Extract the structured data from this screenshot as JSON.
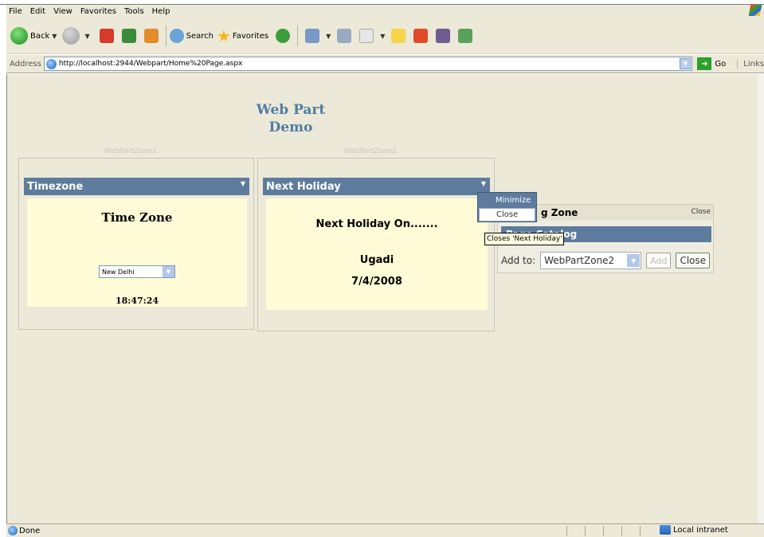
{
  "browser": {
    "menu": [
      "File",
      "Edit",
      "View",
      "Favorites",
      "Tools",
      "Help"
    ],
    "toolbar": {
      "back_label": "Back",
      "search_label": "Search",
      "favorites_label": "Favorites"
    },
    "address": {
      "label": "Address",
      "url": "http://localhost:2944/Webpart/Home%20Page.aspx",
      "go_label": "Go",
      "links_label": "Links"
    },
    "status": {
      "text": "Done",
      "zone": "Local intranet"
    }
  },
  "page": {
    "title_line1": "Web Part",
    "title_line2": "Demo",
    "zone1": {
      "label": "WebPartZone1",
      "part_title": "Timezone",
      "heading": "Time Zone",
      "timezone_value": "New Delhi",
      "time": "18:47:24"
    },
    "zone2": {
      "label": "WebPartZone2",
      "part_title": "Next Holiday",
      "line1": "Next Holiday On.......",
      "holiday": "Ugadi",
      "date": "7/4/2008"
    },
    "context_menu": {
      "minimize": "Minimize",
      "close": "Close"
    },
    "tooltip": "Closes 'Next Holiday'",
    "catalog": {
      "header": "g Zone",
      "close_link": "Close",
      "catalog_title": "Page Catalog",
      "add_to_label": "Add to:",
      "add_to_value": "WebPartZone2",
      "add_button": "Add",
      "close_button": "Close"
    }
  },
  "colors": {
    "webpart_title_bg": "#5d7b9d",
    "webpart_body_bg": "#fffbd6",
    "page_title": "#4f7ca5",
    "chrome_bg": "#ece9d8"
  }
}
